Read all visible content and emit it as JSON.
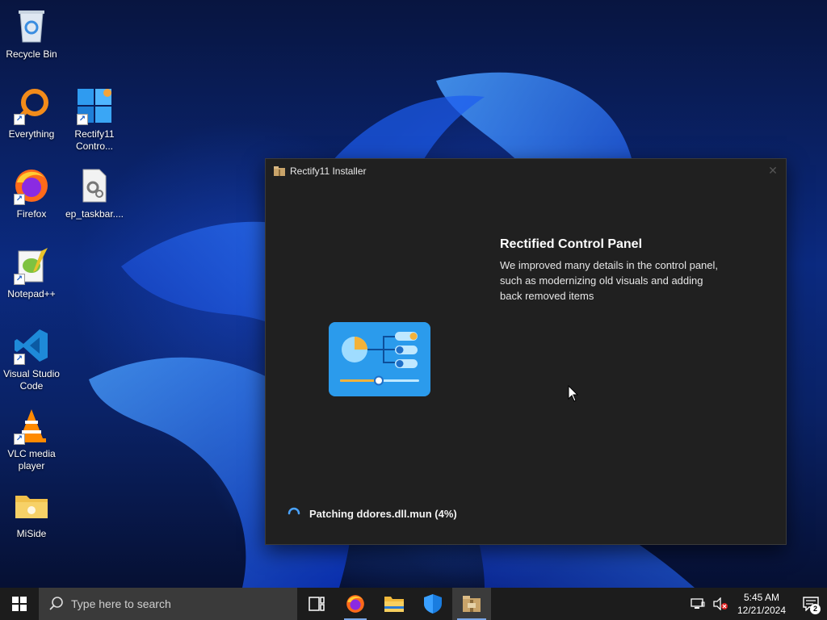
{
  "desktop": {
    "icons": [
      {
        "label": "Recycle Bin",
        "icon": "recycle-bin-icon"
      },
      {
        "label": "Everything",
        "icon": "everything-search-icon"
      },
      {
        "label": "Rectify11 Contro...",
        "icon": "rectify11-control-icon"
      },
      {
        "label": "Firefox",
        "icon": "firefox-icon"
      },
      {
        "label": "ep_taskbar....",
        "icon": "settings-file-icon"
      },
      {
        "label": "Notepad++",
        "icon": "notepadpp-icon"
      },
      {
        "label": "Visual Studio Code",
        "icon": "vscode-icon"
      },
      {
        "label": "VLC media player",
        "icon": "vlc-icon"
      },
      {
        "label": "MiSide",
        "icon": "folder-icon"
      }
    ]
  },
  "installer": {
    "title": "Rectify11 Installer",
    "feature_title": "Rectified Control Panel",
    "feature_description": "We improved many details in the control panel, such as modernizing old visuals and adding back removed items",
    "status": "Patching ddores.dll.mun (4%)"
  },
  "taskbar": {
    "search_placeholder": "Type here to search",
    "pinned": [
      "task-view-icon",
      "firefox-icon",
      "file-explorer-icon",
      "security-shield-icon",
      "installer-icon"
    ],
    "clock_time": "5:45 AM",
    "clock_date": "12/21/2024",
    "notification_count": "2"
  },
  "colors": {
    "window_bg": "#202020",
    "taskbar_bg": "#1c1c1c",
    "accent": "#7aa7e8"
  }
}
